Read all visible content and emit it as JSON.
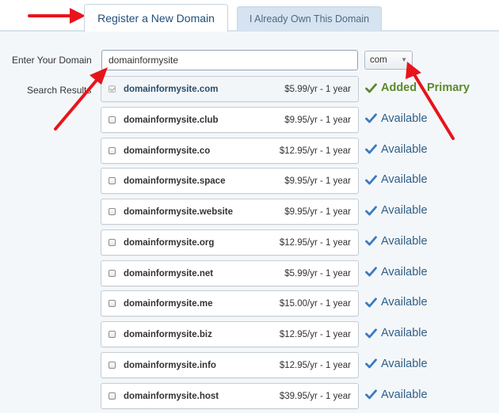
{
  "tabs": [
    {
      "label": "Register a New Domain",
      "active": true
    },
    {
      "label": "I Already Own This Domain",
      "active": false
    }
  ],
  "form": {
    "domain_label": "Enter Your Domain",
    "domain_value": "domainformysite",
    "tld_value": "com",
    "results_label": "Search Results"
  },
  "results": [
    {
      "domain": "domainformysite.com",
      "price": "$5.99/yr - 1 year",
      "status": "Added - Primary",
      "checked": true
    },
    {
      "domain": "domainformysite.club",
      "price": "$9.95/yr - 1 year",
      "status": "Available",
      "checked": false
    },
    {
      "domain": "domainformysite.co",
      "price": "$12.95/yr - 1 year",
      "status": "Available",
      "checked": false
    },
    {
      "domain": "domainformysite.space",
      "price": "$9.95/yr - 1 year",
      "status": "Available",
      "checked": false
    },
    {
      "domain": "domainformysite.website",
      "price": "$9.95/yr - 1 year",
      "status": "Available",
      "checked": false
    },
    {
      "domain": "domainformysite.org",
      "price": "$12.95/yr - 1 year",
      "status": "Available",
      "checked": false
    },
    {
      "domain": "domainformysite.net",
      "price": "$5.99/yr - 1 year",
      "status": "Available",
      "checked": false
    },
    {
      "domain": "domainformysite.me",
      "price": "$15.00/yr - 1 year",
      "status": "Available",
      "checked": false
    },
    {
      "domain": "domainformysite.biz",
      "price": "$12.95/yr - 1 year",
      "status": "Available",
      "checked": false
    },
    {
      "domain": "domainformysite.info",
      "price": "$12.95/yr - 1 year",
      "status": "Available",
      "checked": false
    },
    {
      "domain": "domainformysite.host",
      "price": "$39.95/yr - 1 year",
      "status": "Available",
      "checked": false
    }
  ],
  "colors": {
    "annotation_arrow": "#e8141b",
    "added_status": "#5b8a29",
    "available_status": "#2f5f86",
    "available_check": "#3a7bbf"
  },
  "icons": {
    "status_icon": "check-icon",
    "select_icon": "dropdown-arrow-icon"
  }
}
